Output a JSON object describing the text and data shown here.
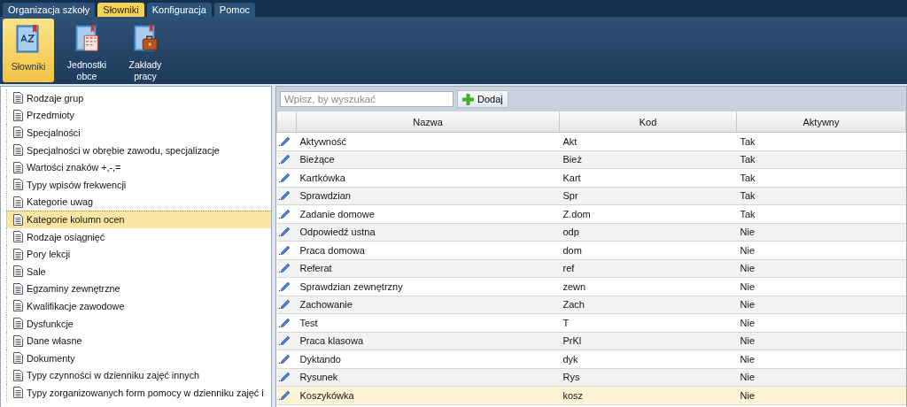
{
  "menu_tabs": [
    {
      "label": "Organizacja szkoły",
      "selected": false
    },
    {
      "label": "Słowniki",
      "selected": true
    },
    {
      "label": "Konfiguracja",
      "selected": false
    },
    {
      "label": "Pomoc",
      "selected": false
    }
  ],
  "ribbon": [
    {
      "label": "Słowniki",
      "kind": "az",
      "selected": true
    },
    {
      "label": "Jednostki obce",
      "kind": "building",
      "selected": false
    },
    {
      "label": "Zakłady pracy",
      "kind": "briefcase",
      "selected": false
    }
  ],
  "sidebar": {
    "items": [
      {
        "label": "Rodzaje grup",
        "selected": false
      },
      {
        "label": "Przedmioty",
        "selected": false
      },
      {
        "label": "Specjalności",
        "selected": false
      },
      {
        "label": "Specjalności w obrębie zawodu, specjalizacje",
        "selected": false
      },
      {
        "label": "Wartości znaków +,-,=",
        "selected": false
      },
      {
        "label": "Typy wpisów frekwencji",
        "selected": false
      },
      {
        "label": "Kategorie uwag",
        "selected": false
      },
      {
        "label": "Kategorie kolumn ocen",
        "selected": true
      },
      {
        "label": "Rodzaje osiągnięć",
        "selected": false
      },
      {
        "label": "Pory lekcji",
        "selected": false
      },
      {
        "label": "Sale",
        "selected": false
      },
      {
        "label": "Egzaminy zewnętrzne",
        "selected": false
      },
      {
        "label": "Kwalifikacje zawodowe",
        "selected": false
      },
      {
        "label": "Dysfunkcje",
        "selected": false
      },
      {
        "label": "Dane własne",
        "selected": false
      },
      {
        "label": "Dokumenty",
        "selected": false
      },
      {
        "label": "Typy czynności w dzienniku zajęć innych",
        "selected": false
      },
      {
        "label": "Typy zorganizowanych form pomocy w dzienniku zajęć i",
        "selected": false
      }
    ]
  },
  "search": {
    "placeholder": "Wpisz, by wyszukać"
  },
  "add_button": "Dodaj",
  "table": {
    "columns": [
      "Nazwa",
      "Kod",
      "Aktywny"
    ],
    "rows": [
      {
        "cells": [
          "Aktywność",
          "Akt",
          "Tak"
        ],
        "selected": false
      },
      {
        "cells": [
          "Bieżące",
          "Bież",
          "Tak"
        ],
        "selected": false
      },
      {
        "cells": [
          "Kartkówka",
          "Kart",
          "Tak"
        ],
        "selected": false
      },
      {
        "cells": [
          "Sprawdzian",
          "Spr",
          "Tak"
        ],
        "selected": false
      },
      {
        "cells": [
          "Zadanie domowe",
          "Z.dom",
          "Tak"
        ],
        "selected": false
      },
      {
        "cells": [
          "Odpowiedź ustna",
          "odp",
          "Nie"
        ],
        "selected": false
      },
      {
        "cells": [
          "Praca domowa",
          "dom",
          "Nie"
        ],
        "selected": false
      },
      {
        "cells": [
          "Referat",
          "ref",
          "Nie"
        ],
        "selected": false
      },
      {
        "cells": [
          "Sprawdzian zewnętrzny",
          "zewn",
          "Nie"
        ],
        "selected": false
      },
      {
        "cells": [
          "Zachowanie",
          "Zach",
          "Nie"
        ],
        "selected": false
      },
      {
        "cells": [
          "Test",
          "T",
          "Nie"
        ],
        "selected": false
      },
      {
        "cells": [
          "Praca klasowa",
          "PrKl",
          "Nie"
        ],
        "selected": false
      },
      {
        "cells": [
          "Dyktando",
          "dyk",
          "Nie"
        ],
        "selected": false
      },
      {
        "cells": [
          "Rysunek",
          "Rys",
          "Nie"
        ],
        "selected": false
      },
      {
        "cells": [
          "Koszykówka",
          "kosz",
          "Nie"
        ],
        "selected": true
      }
    ]
  }
}
